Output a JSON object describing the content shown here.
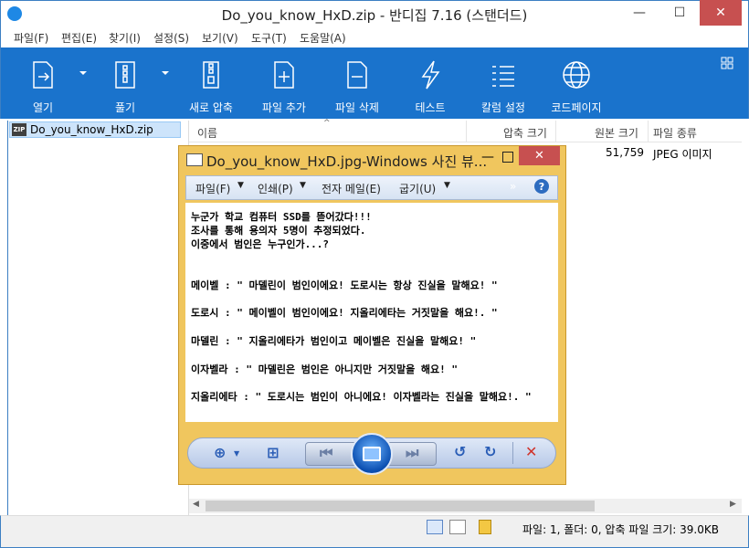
{
  "window": {
    "title": "Do_you_know_HxD.zip - 반디집 7.16 (스탠더드)",
    "min": "—",
    "max": "☐",
    "close": "✕"
  },
  "menu": [
    "파일(F)",
    "편집(E)",
    "찾기(I)",
    "설정(S)",
    "보기(V)",
    "도구(T)",
    "도움말(A)"
  ],
  "toolbar": [
    "열기",
    "풀기",
    "새로 압축",
    "파일 추가",
    "파일 삭제",
    "테스트",
    "칼럼 설정",
    "코드페이지"
  ],
  "tree": {
    "item": "Do_you_know_HxD.zip",
    "zip_badge": "ZIP"
  },
  "list": {
    "columns": [
      "이름",
      "압축 크기",
      "원본 크기",
      "파일 종류"
    ],
    "row": {
      "original_size": "51,759",
      "type": "JPEG 이미지"
    }
  },
  "status": "파일: 1, 폴더: 0, 압축 파일 크기: 39.0KB",
  "viewer": {
    "title": "Do_you_know_HxD.jpg-Windows 사진 뷰...",
    "menu": [
      "파일(F)",
      "인쇄(P)",
      "전자 메일(E)",
      "굽기(U)"
    ],
    "help": "?",
    "chevron": "»",
    "text_lines": [
      "누군가 학교 컴퓨터 SSD를 뜯어갔다!!!",
      "조사를 통해 용의자 5명이 추정되었다.",
      "이중에서 범인은 누구인가...?",
      "메이벨 : \" 마델린이 범인이에요! 도로시는 항상 진실을 말해요! \"",
      "도로시 : \" 메이벨이 범인이에요! 지올리에타는 거짓말을 해요!. \"",
      "마델린 : \" 지올리에타가 범인이고 메이벨은 진실을 말해요! \"",
      "이자벨라 : \" 마델린은 범인은 아니지만 거짓말을 해요! \"",
      "지올리에타 : \" 도로시는 범인이 아니에요! 이자벨라는 진실을 말해요!. \""
    ]
  }
}
